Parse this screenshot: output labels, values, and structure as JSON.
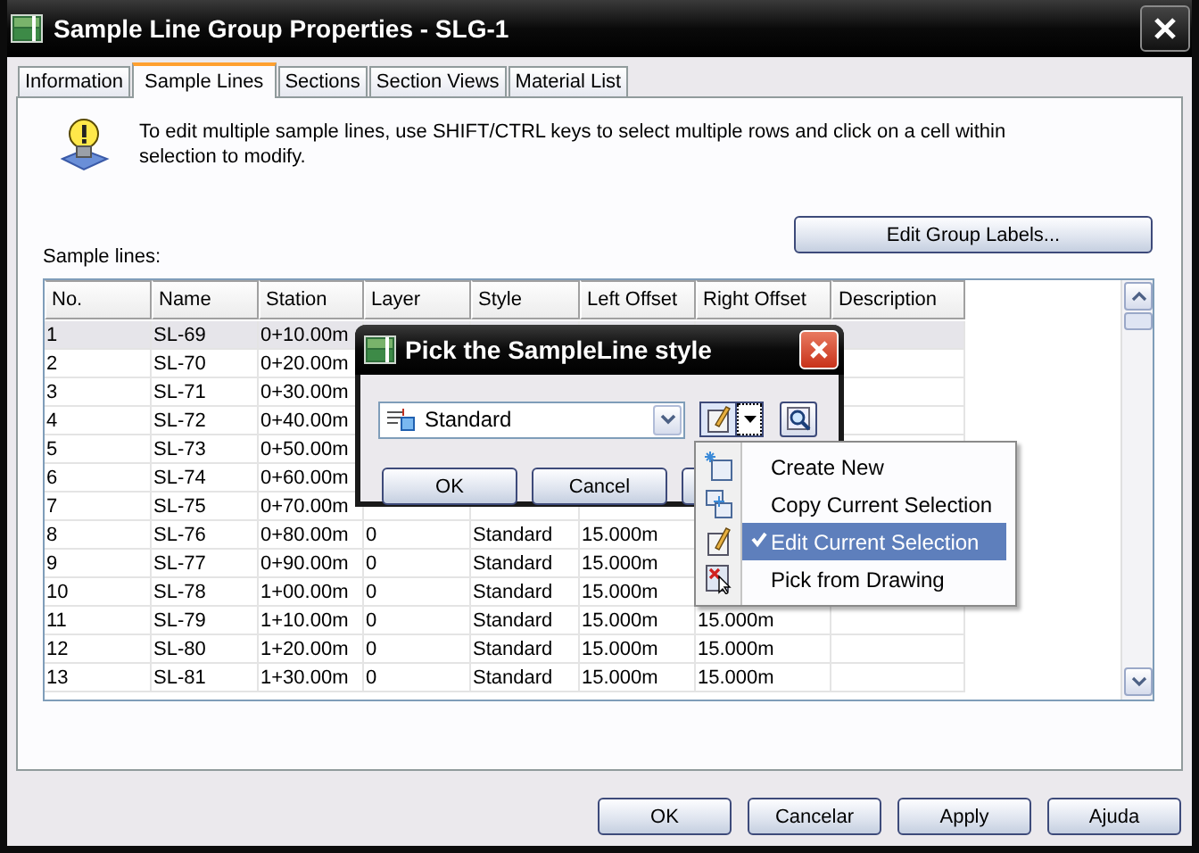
{
  "window": {
    "title": "Sample Line Group Properties - SLG-1"
  },
  "tabs": [
    {
      "label": "Information",
      "selected": false
    },
    {
      "label": "Sample Lines",
      "selected": true
    },
    {
      "label": "Sections",
      "selected": false
    },
    {
      "label": "Section Views",
      "selected": false
    },
    {
      "label": "Material List",
      "selected": false
    }
  ],
  "info": {
    "text": "To edit multiple sample lines, use SHIFT/CTRL keys to select multiple rows and click on a cell within selection to modify.",
    "button": "Edit Group Labels..."
  },
  "table": {
    "label": "Sample lines:",
    "columns": [
      "No.",
      "Name",
      "Station",
      "Layer",
      "Style",
      "Left Offset",
      "Right Offset",
      "Description"
    ],
    "rows": [
      {
        "no": "1",
        "name": "SL-69",
        "station": "0+10.00m",
        "selected": true
      },
      {
        "no": "2",
        "name": "SL-70",
        "station": "0+20.00m",
        "selected": false
      },
      {
        "no": "3",
        "name": "SL-71",
        "station": "0+30.00m",
        "selected": false
      },
      {
        "no": "4",
        "name": "SL-72",
        "station": "0+40.00m",
        "selected": false
      },
      {
        "no": "5",
        "name": "SL-73",
        "station": "0+50.00m",
        "selected": false
      },
      {
        "no": "6",
        "name": "SL-74",
        "station": "0+60.00m",
        "selected": false
      },
      {
        "no": "7",
        "name": "SL-75",
        "station": "0+70.00m",
        "selected": false
      },
      {
        "no": "8",
        "name": "SL-76",
        "station": "0+80.00m",
        "layer": "0",
        "style": "Standard",
        "left_offset": "15.000m",
        "selected": false
      },
      {
        "no": "9",
        "name": "SL-77",
        "station": "0+90.00m",
        "layer": "0",
        "style": "Standard",
        "left_offset": "15.000m",
        "selected": false
      },
      {
        "no": "10",
        "name": "SL-78",
        "station": "1+00.00m",
        "layer": "0",
        "style": "Standard",
        "left_offset": "15.000m",
        "selected": false
      },
      {
        "no": "11",
        "name": "SL-79",
        "station": "1+10.00m",
        "layer": "0",
        "style": "Standard",
        "left_offset": "15.000m",
        "right_offset": "15.000m",
        "selected": false
      },
      {
        "no": "12",
        "name": "SL-80",
        "station": "1+20.00m",
        "layer": "0",
        "style": "Standard",
        "left_offset": "15.000m",
        "right_offset": "15.000m",
        "selected": false
      },
      {
        "no": "13",
        "name": "SL-81",
        "station": "1+30.00m",
        "layer": "0",
        "style": "Standard",
        "left_offset": "15.000m",
        "right_offset": "15.000m",
        "selected": false
      }
    ]
  },
  "picker": {
    "title": "Pick the SampleLine style",
    "style": "Standard",
    "buttons": [
      "OK",
      "Cancel"
    ]
  },
  "menu": {
    "items": [
      {
        "label": "Create New",
        "kind": "new",
        "checked": false,
        "selected": false
      },
      {
        "label": "Copy Current Selection",
        "kind": "copy",
        "checked": false,
        "selected": false
      },
      {
        "label": "Edit Current Selection",
        "kind": "edit",
        "checked": true,
        "selected": true
      },
      {
        "label": "Pick from Drawing",
        "kind": "pick",
        "checked": false,
        "selected": false
      }
    ]
  },
  "buttons": [
    "OK",
    "Cancelar",
    "Apply",
    "Ajuda"
  ]
}
